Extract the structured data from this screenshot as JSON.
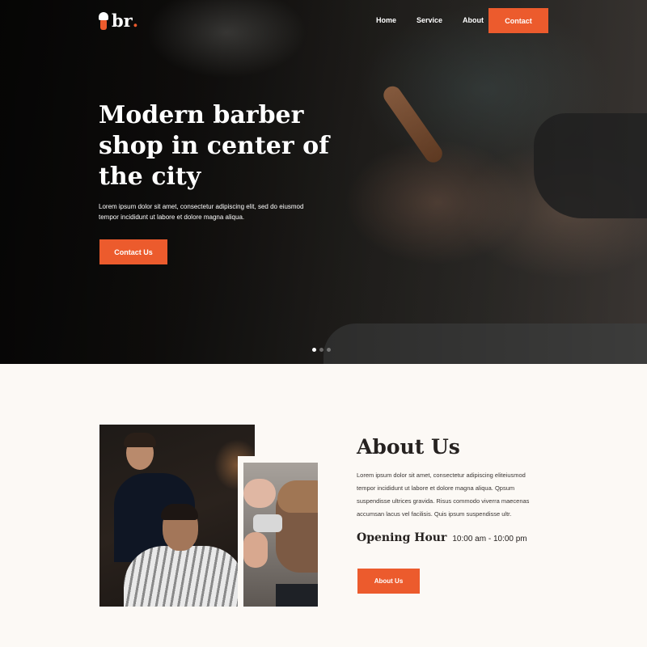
{
  "brand": {
    "logo_text": "br",
    "logo_dot": ".",
    "accent": "#ec5b2d"
  },
  "nav": {
    "items": [
      {
        "label": "Home"
      },
      {
        "label": "Service"
      },
      {
        "label": "About"
      }
    ],
    "contact_label": "Contact"
  },
  "hero": {
    "title": "Modern barber shop in center of the city",
    "description": "Lorem ipsum dolor sit amet, consectetur adipiscing elit, sed do eiusmod tempor incididunt ut labore et dolore magna aliqua.",
    "cta_label": "Contact Us",
    "slider": {
      "count": 3,
      "active": 0
    }
  },
  "about": {
    "title": "About Us",
    "description": "Lorem ipsum dolor sit amet, consectetur adipiscing eliteiusmod tempor incididunt ut labore et dolore magna aliqua. Qpsum suspendisse ultrices gravida. Risus commodo viverra maecenas accumsan lacus vel facilisis. Quis ipsum suspendisse ultr.",
    "opening_label": "Opening Hour",
    "opening_hours": "10:00 am - 10:00 pm",
    "button_label": "About Us"
  }
}
